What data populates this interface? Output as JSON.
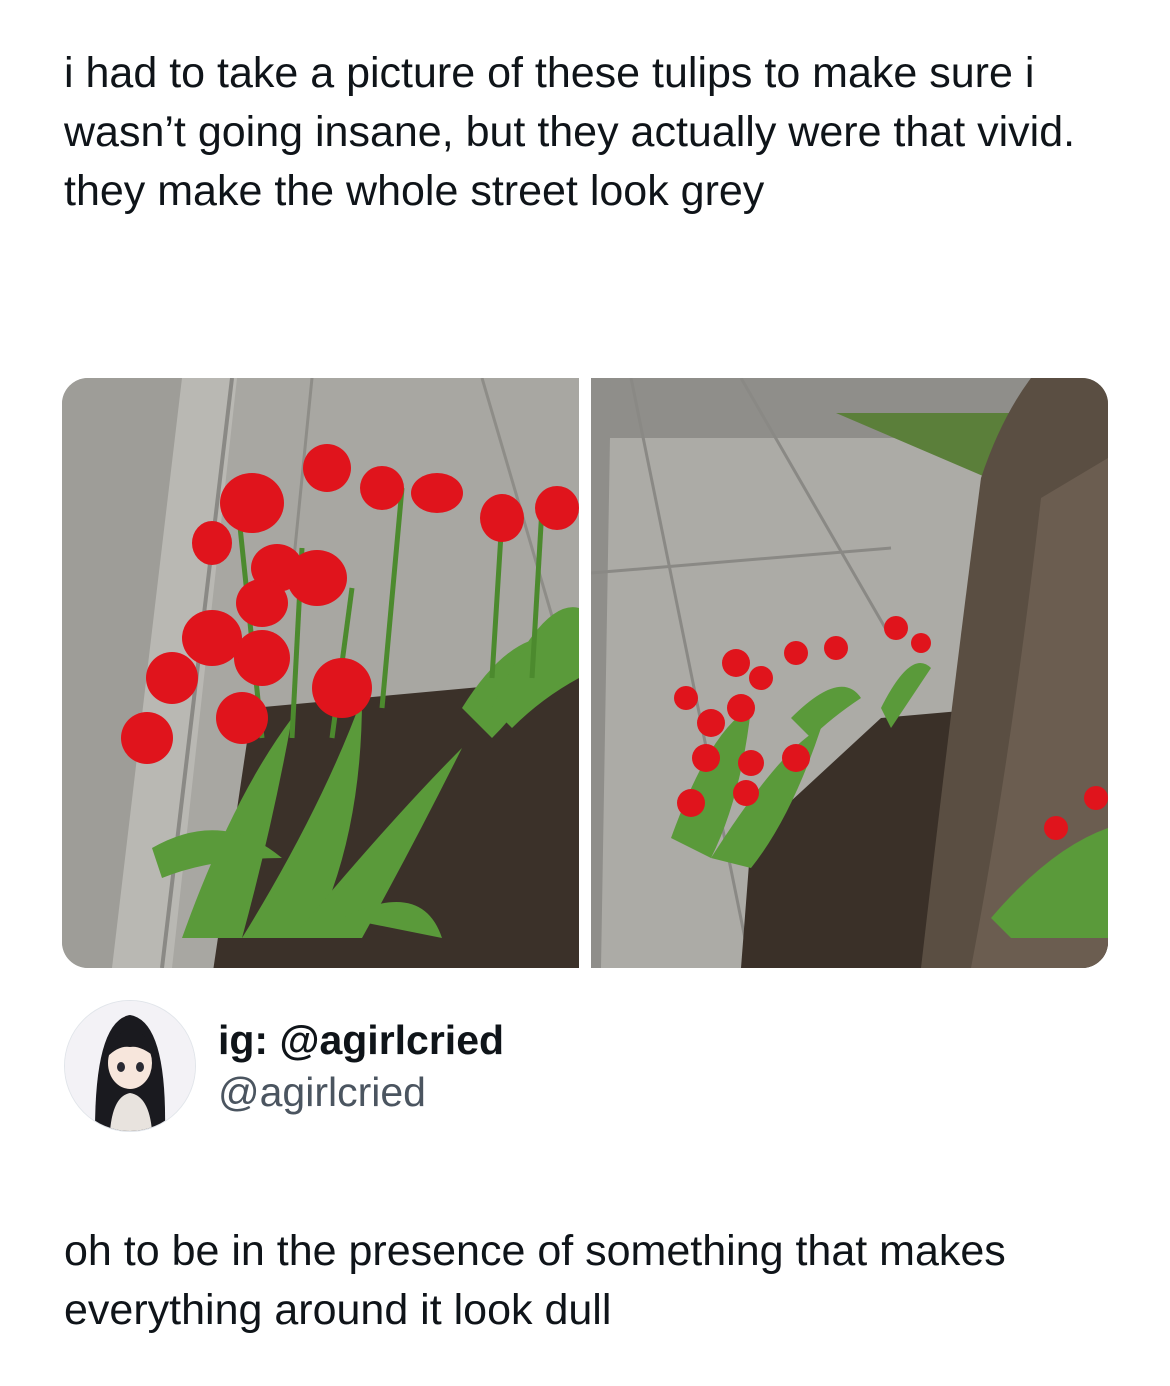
{
  "post": {
    "text": "i had to take a picture of these tulips to make sure i wasn’t going insane, but they actually were that vivid. they make the whole street look grey"
  },
  "media": [
    {
      "subject": "red tulips in sidewalk planting strip, close-up"
    },
    {
      "subject": "red tulips at the base of a tree beside a sidewalk"
    }
  ],
  "author": {
    "display_name": "ig: @agirlcried",
    "handle": "@agirlcried",
    "avatar_icon": "anime-girl-avatar"
  },
  "reply": {
    "text": "oh to be in the presence of something that makes everything around it look dull"
  },
  "colors": {
    "tulip": "#e0141c",
    "leaf": "#5c9a3c",
    "concrete": "#a9a8a3",
    "soil": "#3a3028"
  }
}
